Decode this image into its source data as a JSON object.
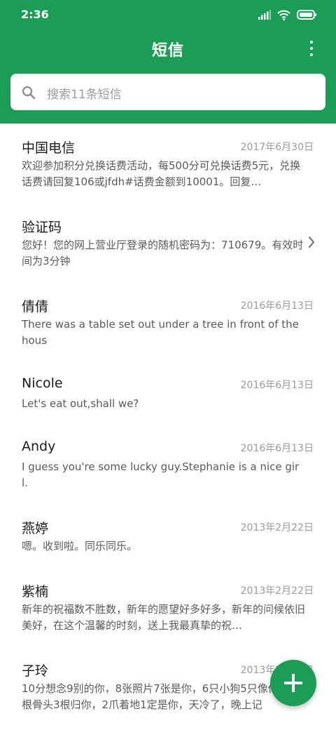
{
  "status_bar": {
    "time": "2:36",
    "icons": [
      "signal-icon",
      "wifi-icon",
      "battery-icon"
    ]
  },
  "header": {
    "title": "短信",
    "more_icon": "more-vertical-icon",
    "background_color": "#1c9d56"
  },
  "search": {
    "placeholder": "搜索11条短信",
    "icon": "search-icon"
  },
  "messages": [
    {
      "name": "中国电信",
      "date": "2017年6月30日",
      "preview": "欢迎参加积分兑换话费活动，每500分可兑换话费5元，兑换话费请回复106或jfdh#话费金额到10001。回复…"
    },
    {
      "name": "验证码",
      "date": "",
      "preview": "您好！您的网上营业厅登录的随机密码为：710679。有效时间为3分钟"
    },
    {
      "name": "倩倩",
      "date": "2016年6月13日",
      "preview": "There was a table set out under a tree in front of the hous"
    },
    {
      "name": "Nicole",
      "date": "2016年6月13日",
      "preview": "Let's eat out,shall we?"
    },
    {
      "name": "Andy",
      "date": "2016年6月13日",
      "preview": "I guess you're some lucky guy.Stephanie is a nice girl."
    },
    {
      "name": "燕婷",
      "date": "2013年2月22日",
      "preview": "嗯。收到啦。同乐同乐。"
    },
    {
      "name": "紫楠",
      "date": "2013年2月22日",
      "preview": "新年的祝福数不胜数，新年的愿望好多好多，新年的问候依旧美好，在这个温馨的时刻，送上我最真挚的祝…"
    },
    {
      "name": "子玲",
      "date": "2013年2月22日",
      "preview": "10分想念9别的你，8张照片7张是你，6只小狗5只像你，4根骨头3根归你，2爪着地1定是你，天冷了，晚上记"
    }
  ],
  "fab": {
    "icon": "plus-icon"
  }
}
